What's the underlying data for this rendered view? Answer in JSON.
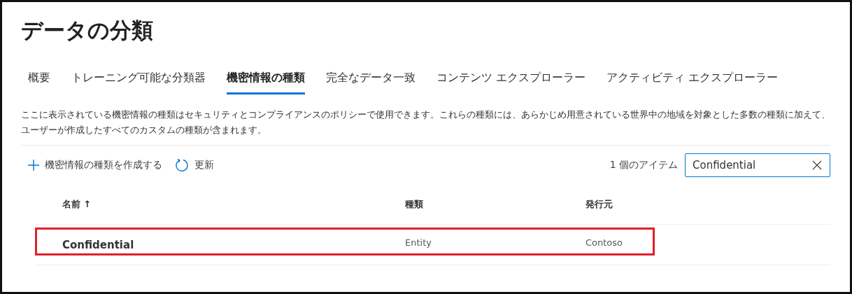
{
  "page": {
    "title": "データの分類"
  },
  "tabs": [
    {
      "label": "概要",
      "selected": false
    },
    {
      "label": "トレーニング可能な分類器",
      "selected": false
    },
    {
      "label": "機密情報の種類",
      "selected": true
    },
    {
      "label": "完全なデータ一致",
      "selected": false
    },
    {
      "label": "コンテンツ エクスプローラー",
      "selected": false
    },
    {
      "label": "アクティビティ エクスプローラー",
      "selected": false
    }
  ],
  "description": "ここに表示されている機密情報の種類はセキュリティとコンプライアンスのポリシーで使用できます。これらの種類には、あらかじめ用意されている世界中の地域を対象とした多数の種類に加えて、ユーザーが作成したすべてのカスタムの種類が含まれます。",
  "toolbar": {
    "create": "機密情報の種類を作成する",
    "refresh": "更新",
    "count": "1 個のアイテム",
    "search_value": "Confidential"
  },
  "table": {
    "columns": [
      "名前 ↑",
      "種類",
      "発行元"
    ],
    "rows": [
      {
        "cells": [
          "Confidential",
          "Entity",
          "Contoso"
        ],
        "highlighted": true
      }
    ]
  }
}
